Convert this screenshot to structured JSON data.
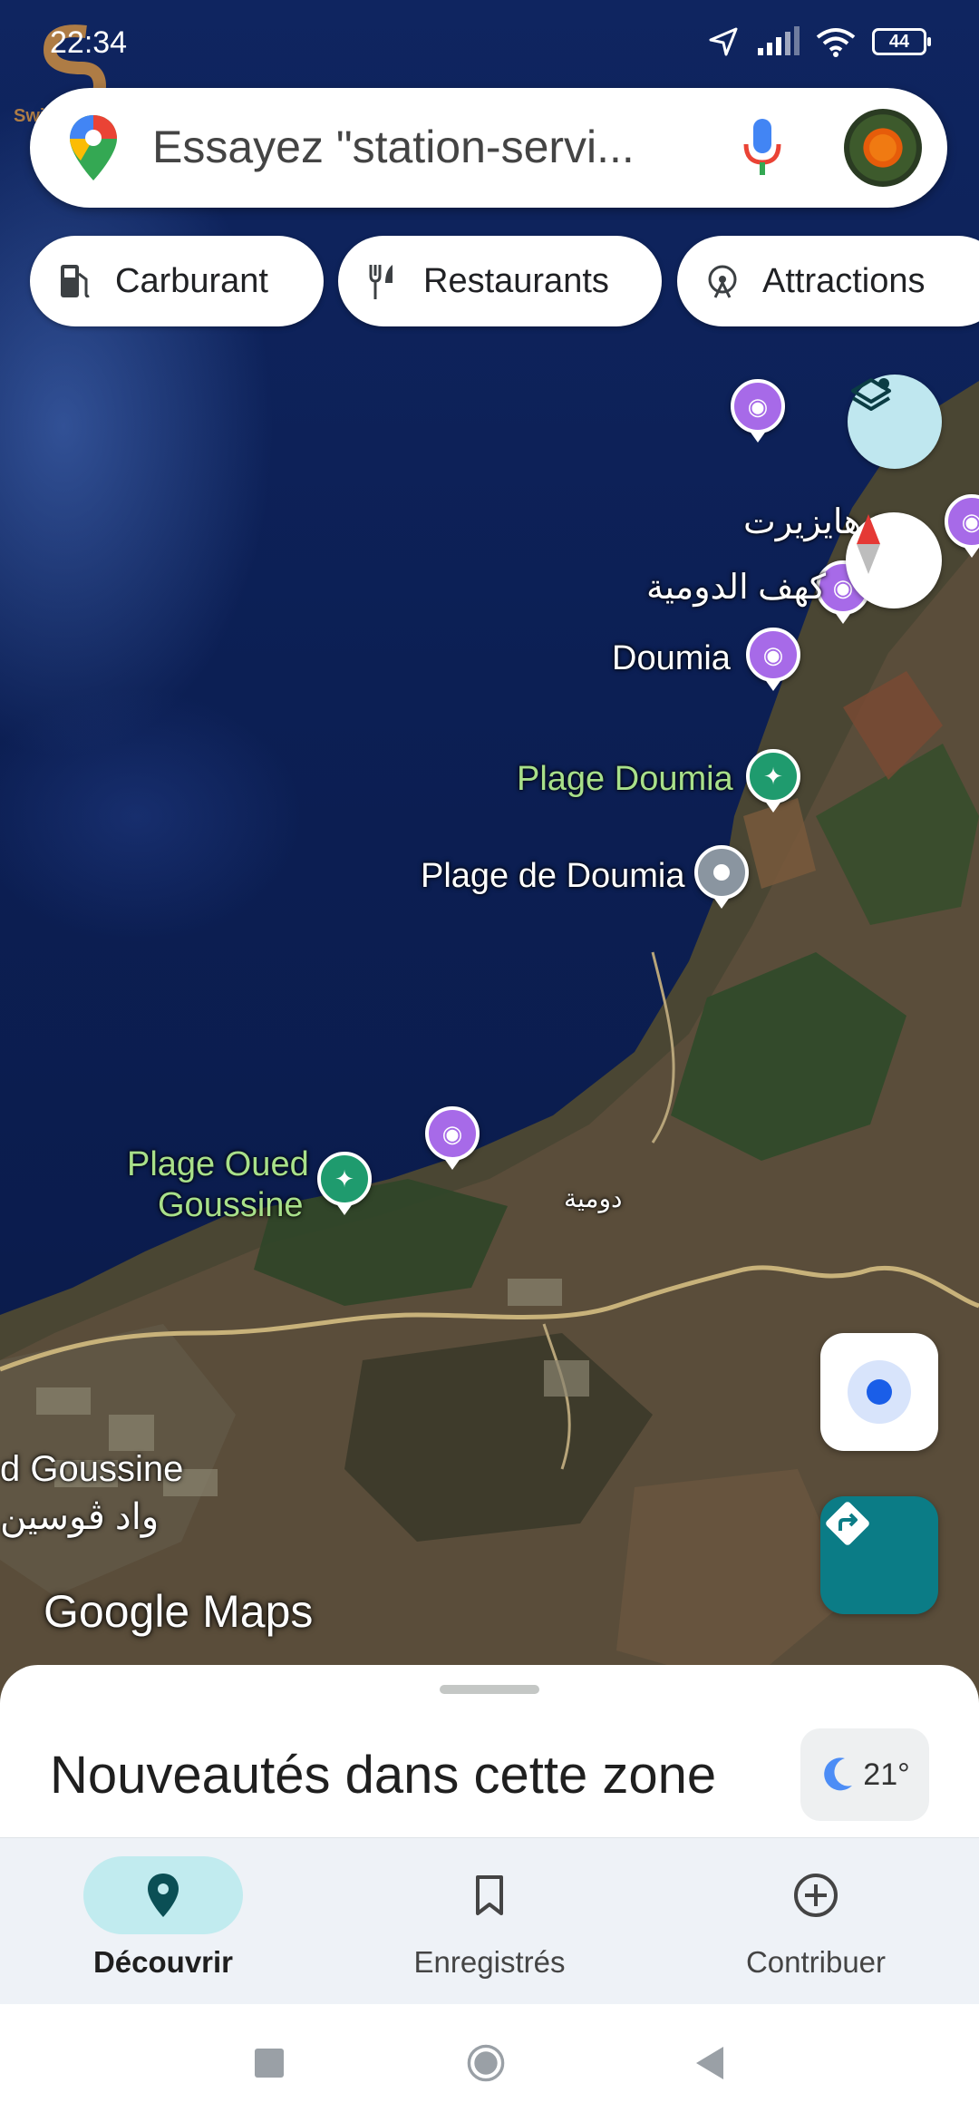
{
  "status_bar": {
    "time": "22:34",
    "battery": "44"
  },
  "watermark": {
    "text": "Swiga سويقة"
  },
  "search": {
    "placeholder": "Essayez \"station-servi..."
  },
  "chips": [
    {
      "label": "Carburant",
      "icon": "fuel-icon"
    },
    {
      "label": "Restaurants",
      "icon": "restaurant-icon"
    },
    {
      "label": "Attractions",
      "icon": "attractions-icon"
    }
  ],
  "map": {
    "labels": {
      "haizirt": "ة هايزيرت",
      "doumia_cave": "كهف الدومية",
      "doumia": "Doumia",
      "plage_doumia": "Plage Doumia",
      "plage_de_doumia": "Plage de Doumia",
      "plage_oued_line1": "Plage Oued",
      "plage_oued_line2": "Goussine",
      "doumia_ar": "دومية",
      "oued_goussine": "d Goussine",
      "oued_goussine_ar": "واد ڨوسين"
    },
    "logo": "Google Maps"
  },
  "sheet": {
    "title": "Nouveautés dans cette zone",
    "temperature": "21°"
  },
  "bottom_nav": {
    "items": [
      {
        "label": "Découvrir",
        "active": true
      },
      {
        "label": "Enregistrés",
        "active": false
      },
      {
        "label": "Contribuer",
        "active": false
      }
    ]
  },
  "colors": {
    "accent_teal": "#0b7c86",
    "active_pill": "#c1ebef",
    "poi_purple": "#a76ae8",
    "poi_green": "#1f9b6e",
    "location_blue": "#1a5ee8"
  }
}
